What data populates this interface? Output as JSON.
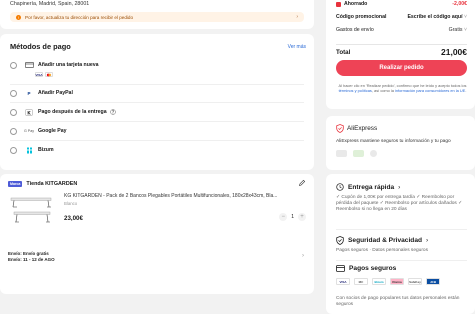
{
  "address": {
    "line": "Chapinería, Madrid, Spain, 28001",
    "warning": "Por favor, actualiza tu dirección para recibir el pedido"
  },
  "payment": {
    "title": "Métodos de pago",
    "see_more": "Ver más",
    "options": [
      {
        "label": "Añadir una tarjeta nueva",
        "icon": "credit-card-icon"
      },
      {
        "label": "Añadir PayPal",
        "icon": "paypal-icon"
      },
      {
        "label": "Pago después de la entrega",
        "icon": "klarna-icon"
      },
      {
        "label": "Google Pay",
        "icon": "google-pay-icon",
        "icon_text": "G Pay"
      },
      {
        "label": "Bizum",
        "icon": "bizum-icon"
      }
    ],
    "card_logos": [
      "VISA",
      "MC"
    ]
  },
  "order": {
    "store_badge": "Marca",
    "store_name": "Tienda KITGARDEN",
    "product_title": "KG KITGARDEN - Pack de 2 Bancos Plegables Portátiles Multifuncionales, 180x28x43cm, Bla...",
    "product_color": "Blanco",
    "product_price": "23,00€",
    "quantity": "1",
    "shipping_line1": "Envío: Envío gratis",
    "shipping_line2": "Envío: 11 - 12 de AGO"
  },
  "summary": {
    "saved_label": "Ahorrado",
    "saved_value": "-2,00€",
    "promo_label": "Código promocional",
    "promo_value": "Escribe el código aquí",
    "shipping_label": "Gastos de envío",
    "shipping_value": "Gratis",
    "total_label": "Total",
    "total_value": "21,00€",
    "order_button": "Realizar pedido",
    "legal_part1": "Al hacer clic en 'Realizar pedido', confirmo que he leído y acepto todos los ",
    "legal_link1": "términos y políticas",
    "legal_part2": ", así como la ",
    "legal_link2": "información para consumidores en la UE",
    "legal_part3": "."
  },
  "trust": {
    "brand": "AliExpress",
    "text": "AliExpress mantiene seguros tu información y tu pago"
  },
  "benefits": {
    "delivery_title": "Entrega rápida",
    "delivery_text": "✓ Cupón de 1,00€ por entrega tardía ✓ Reembolso por pérdida del paquete ✓ Reembolso por artículos dañados ✓ Reembolso si no llega en 20 días",
    "security_title": "Seguridad & Privacidad",
    "security_text": "Pagos seguros · Datos personales seguros",
    "payments_title": "Pagos seguros",
    "payments_text": "Con socios de pago populares tus datos personales están seguros",
    "payment_logos": [
      "VISA",
      "MC",
      "Bizum",
      "Klarna",
      "SafeKey",
      "JCB"
    ]
  },
  "colors": {
    "accent": "#ee4356",
    "link": "#2a6ad6",
    "warning_bg": "#fff3e6"
  }
}
